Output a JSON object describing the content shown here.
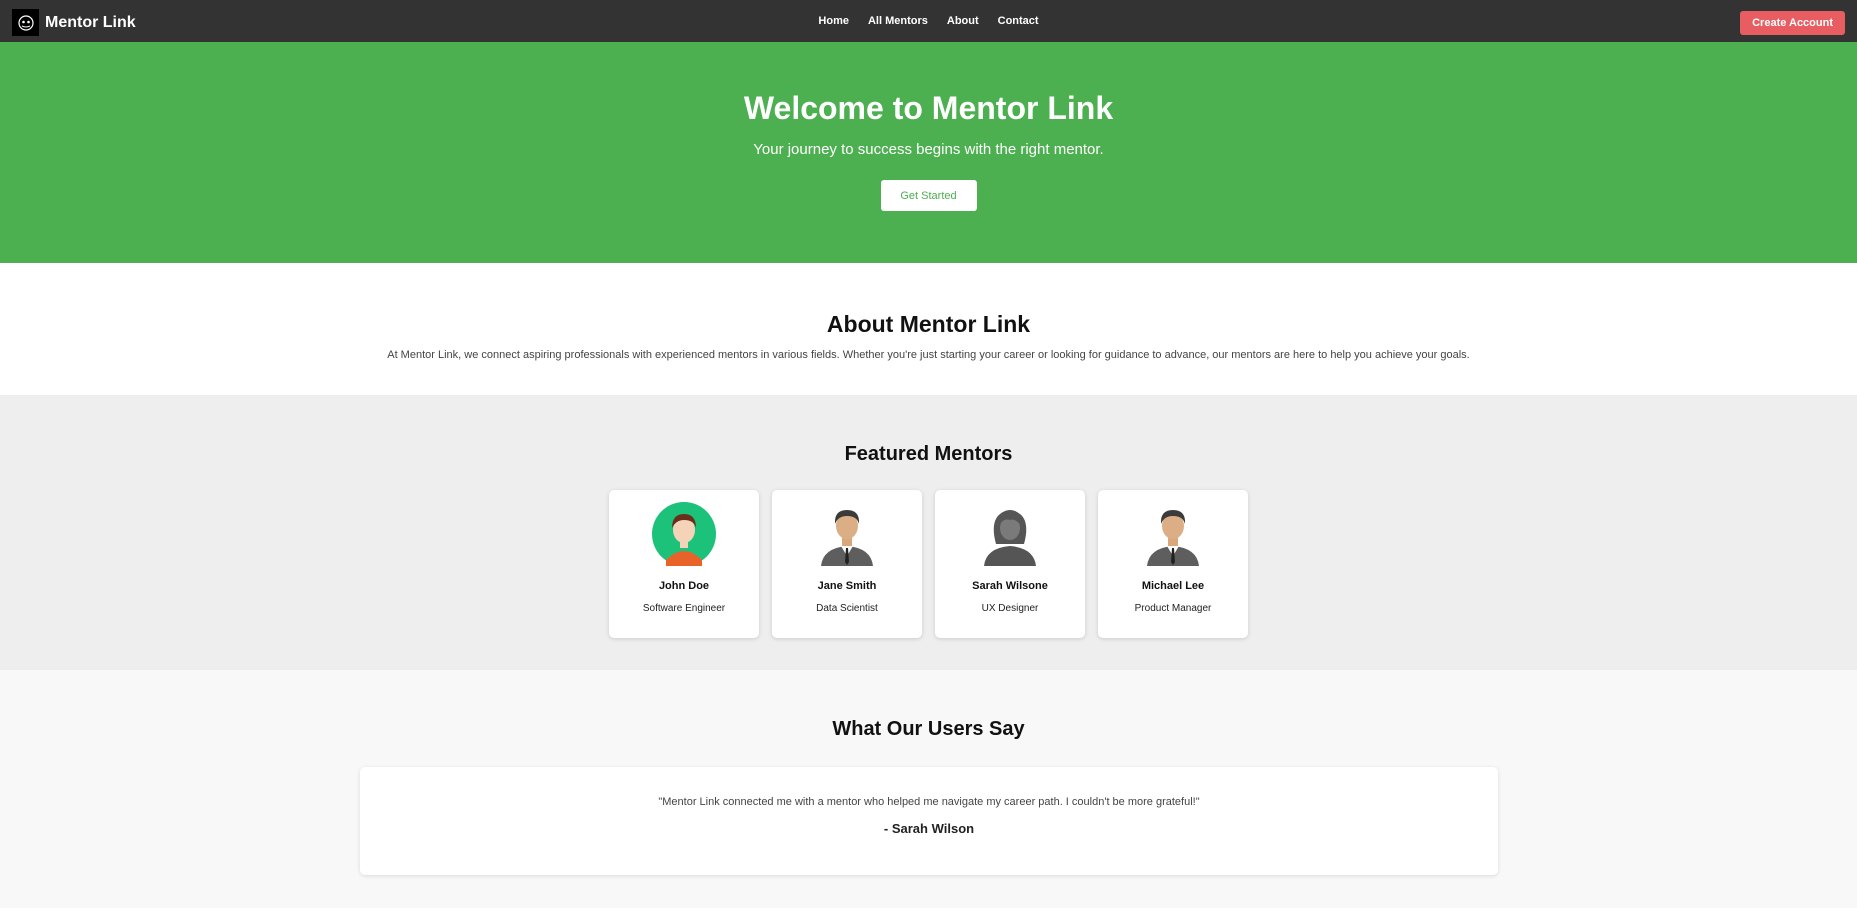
{
  "navbar": {
    "brand": "Mentor Link",
    "links": [
      "Home",
      "All Mentors",
      "About",
      "Contact"
    ],
    "create_account": "Create Account"
  },
  "hero": {
    "title": "Welcome to Mentor Link",
    "subtitle": "Your journey to success begins with the right mentor.",
    "cta": "Get Started"
  },
  "about": {
    "title": "About Mentor Link",
    "text": "At Mentor Link, we connect aspiring professionals with experienced mentors in various fields. Whether you're just starting your career or looking for guidance to advance, our mentors are here to help you achieve your goals."
  },
  "featured": {
    "title": "Featured Mentors",
    "mentors": [
      {
        "name": "John Doe",
        "role": "Software Engineer"
      },
      {
        "name": "Jane Smith",
        "role": "Data Scientist"
      },
      {
        "name": "Sarah Wilsone",
        "role": "UX Designer"
      },
      {
        "name": "Michael Lee",
        "role": "Product Manager"
      }
    ]
  },
  "testimonials": {
    "title": "What Our Users Say",
    "quote": "\"Mentor Link connected me with a mentor who helped me navigate my career path. I couldn't be more grateful!\"",
    "author": "- Sarah Wilson"
  },
  "colors": {
    "navbar": "#333333",
    "hero": "#4caf50",
    "create_account": "#e85d61"
  }
}
